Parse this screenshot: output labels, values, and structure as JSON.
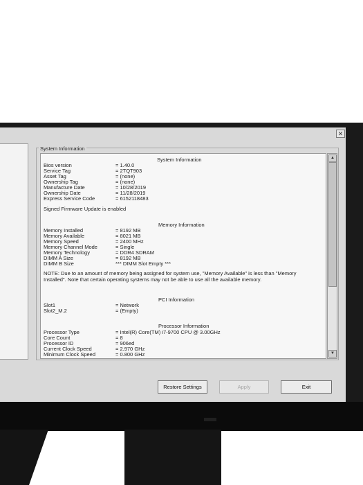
{
  "dialog": {
    "close_glyph": "✕",
    "group_title": "System Information"
  },
  "system": {
    "title": "System Information",
    "rows": [
      {
        "label": "Bios version",
        "value": "= 1.40.0"
      },
      {
        "label": "Service Tag",
        "value": "= 2TQT903"
      },
      {
        "label": "Asset Tag",
        "value": "= (none)"
      },
      {
        "label": "Ownership Tag",
        "value": "= (none)"
      },
      {
        "label": "Manufacture Date",
        "value": "= 10/28/2019"
      },
      {
        "label": "Ownership Date",
        "value": "= 11/28/2019"
      },
      {
        "label": "Express Service Code",
        "value": "= 6152118483"
      }
    ],
    "firmware_note": "Signed Firmware Update is enabled"
  },
  "memory": {
    "title": "Memory Information",
    "rows": [
      {
        "label": "Memory Installed",
        "value": "= 8192 MB"
      },
      {
        "label": "Memory Available",
        "value": "= 8021 MB"
      },
      {
        "label": "Memory Speed",
        "value": "= 2400 MHz"
      },
      {
        "label": "Memory Channel Mode",
        "value": "= Single"
      },
      {
        "label": "Memory Technology",
        "value": "= DDR4 SDRAM"
      },
      {
        "label": "DIMM A Size",
        "value": "= 8192 MB"
      },
      {
        "label": "DIMM B Size",
        "value": "*** DIMM Slot Empty ***"
      }
    ],
    "note": "NOTE: Due to an amount of memory being assigned for system use, \"Memory Available\" is less than \"Memory Installed\". Note that certain operating systems may not be able to use all the available memory."
  },
  "pci": {
    "title": "PCI Information",
    "rows": [
      {
        "label": "Slot1",
        "value": "= Network"
      },
      {
        "label": "Slot2_M.2",
        "value": "= (Empty)"
      }
    ]
  },
  "processor": {
    "title": "Processor Information",
    "rows": [
      {
        "label": "Processor Type",
        "value": "= Intel(R) Core(TM) i7-9700 CPU @ 3.00GHz"
      },
      {
        "label": "Core Count",
        "value": "= 8"
      },
      {
        "label": "Processor ID",
        "value": "= 906ed"
      },
      {
        "label": "Current Clock Speed",
        "value": "= 2.970 GHz"
      },
      {
        "label": "Minimum Clock Speed",
        "value": "= 0.800 GHz"
      }
    ]
  },
  "buttons": {
    "restore": "Restore Settings",
    "apply": "Apply",
    "exit": "Exit"
  },
  "icons": {
    "scroll_up": "scroll-up-arrow-icon",
    "scroll_down": "scroll-down-arrow-icon",
    "close": "close-icon"
  }
}
